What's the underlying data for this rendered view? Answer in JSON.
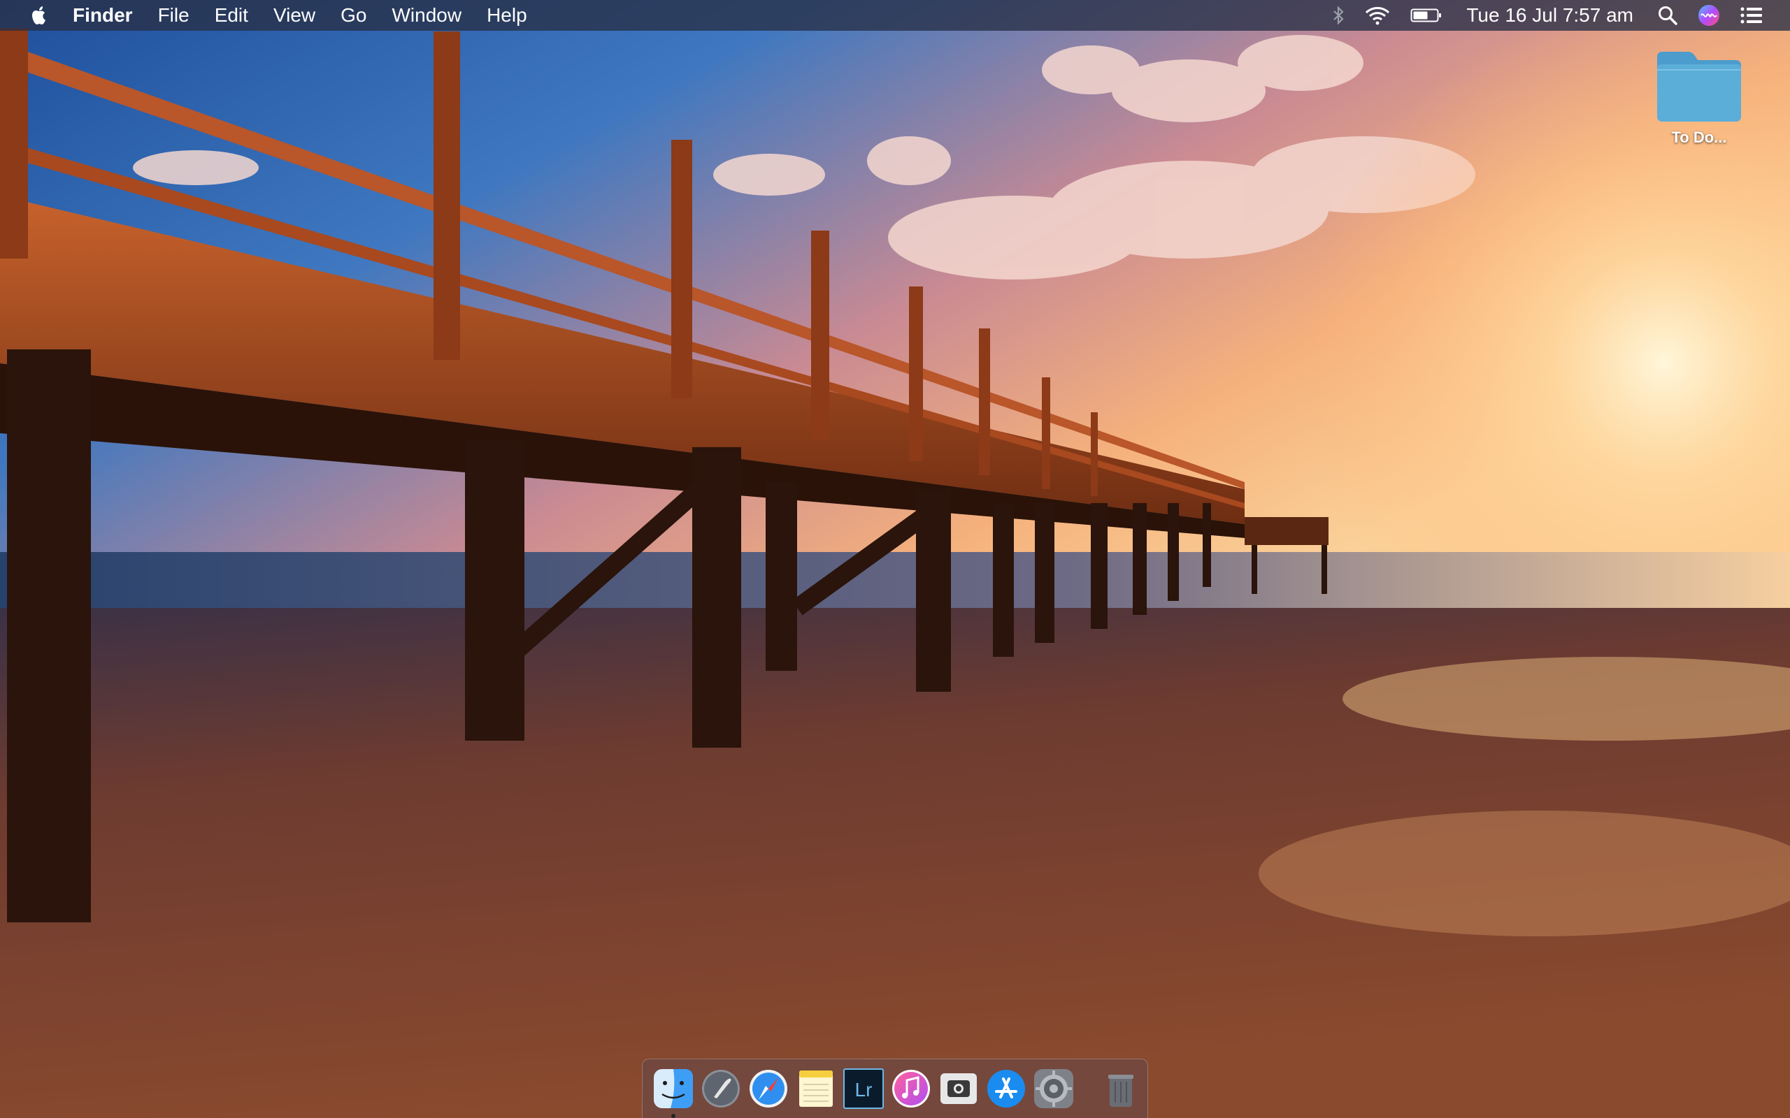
{
  "menubar": {
    "apple_icon": "apple-logo-icon",
    "app_name": "Finder",
    "menus": [
      "File",
      "Edit",
      "View",
      "Go",
      "Window",
      "Help"
    ],
    "status": {
      "bluetooth_icon": "bluetooth-icon",
      "wifi_icon": "wifi-icon",
      "battery_icon": "battery-icon",
      "clock": "Tue 16 Jul  7:57 am",
      "spotlight_icon": "search-icon",
      "siri_icon": "siri-icon",
      "notification_icon": "notification-center-icon"
    }
  },
  "desktop": {
    "icons": [
      {
        "label": "To Do...",
        "icon": "folder-icon",
        "color": "#5aaed8"
      }
    ]
  },
  "dock": {
    "apps": [
      {
        "name": "Finder",
        "icon": "finder-icon",
        "running": true
      },
      {
        "name": "Launchpad",
        "icon": "launchpad-icon",
        "running": false
      },
      {
        "name": "Safari",
        "icon": "safari-icon",
        "running": false
      },
      {
        "name": "Notes",
        "icon": "notes-icon",
        "running": false
      },
      {
        "name": "Lightroom",
        "icon": "lightroom-icon",
        "label": "Lr",
        "running": false
      },
      {
        "name": "iTunes",
        "icon": "itunes-icon",
        "running": false
      },
      {
        "name": "Screenshot",
        "icon": "screenshot-icon",
        "running": false
      },
      {
        "name": "App Store",
        "icon": "app-store-icon",
        "running": false
      },
      {
        "name": "System Preferences",
        "icon": "system-preferences-icon",
        "running": false
      },
      {
        "name": "Trash",
        "icon": "trash-icon",
        "running": false
      }
    ]
  },
  "colors": {
    "menubar_bg": "#283046",
    "folder": "#5aaed8",
    "lightroom_bg": "#0a1c2b",
    "lightroom_text": "#6fb7e8"
  }
}
